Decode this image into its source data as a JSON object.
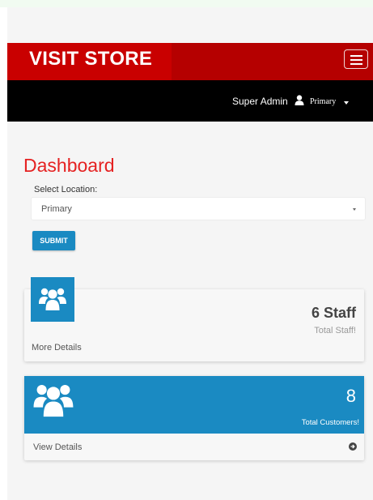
{
  "navbar": {
    "brand": "VISIT STORE",
    "menu_icon": "hamburger-icon"
  },
  "userbar": {
    "user_name": "Super Admin",
    "user_icon": "user-icon",
    "location": "Primary",
    "caret_icon": "caret-down-icon"
  },
  "main": {
    "title": "Dashboard",
    "select_label": "Select Location:",
    "select_value": "Primary",
    "submit_label": "SUBMIT"
  },
  "cards": {
    "staff": {
      "count": "6 Staff",
      "label": "Total Staff!",
      "link": "More Details",
      "icon": "users-icon"
    },
    "customers": {
      "count": "8",
      "label": "Total Customers!",
      "link": "View Details",
      "icon": "users-icon",
      "arrow_icon": "arrow-circle-right-icon"
    }
  },
  "colors": {
    "brand_red": "#c90000",
    "navbar_red": "#b50000",
    "title_red": "#e52222",
    "accent_blue": "#1a8ac2",
    "userbar_bg": "#000000"
  }
}
